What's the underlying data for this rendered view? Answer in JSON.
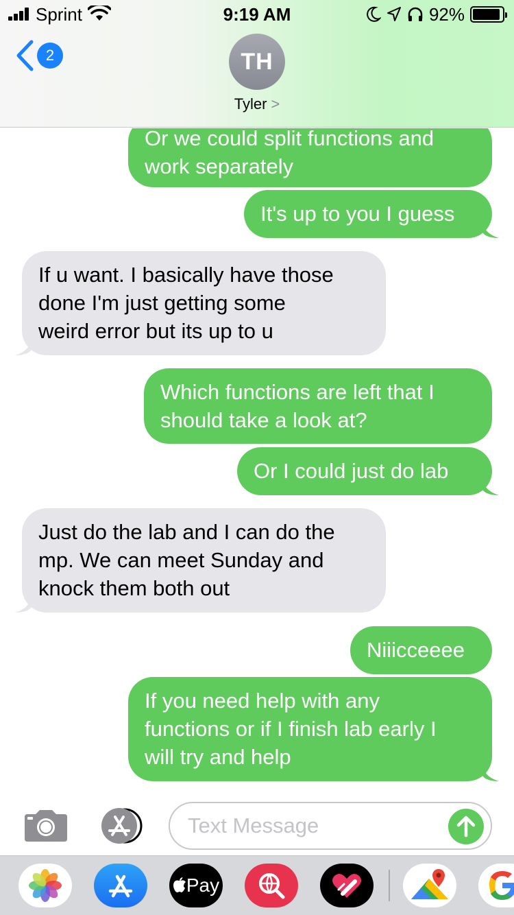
{
  "status_bar": {
    "carrier": "Sprint",
    "time": "9:19 AM",
    "battery_percent": "92%",
    "battery_level": 0.92
  },
  "nav": {
    "back_badge": "2",
    "avatar_initials": "TH",
    "contact_name": "Tyler",
    "contact_chevron": ">"
  },
  "messages": [
    {
      "type": "sent",
      "lines": [
        "Or we could split functions and",
        "work separately"
      ]
    },
    {
      "type": "sent",
      "lines": [
        "It's up to you I guess"
      ]
    },
    {
      "type": "received",
      "lines": [
        "If u want. I basically have those",
        "done I'm just getting some",
        "weird error but its up to u"
      ]
    },
    {
      "type": "sent",
      "lines": [
        "Which functions are left that I",
        "should take a look at?"
      ]
    },
    {
      "type": "sent",
      "lines": [
        "Or I could just do lab"
      ]
    },
    {
      "type": "received",
      "lines": [
        "Just do the lab and I can do the",
        "mp. We can meet Sunday and",
        "knock them both out"
      ]
    },
    {
      "type": "sent",
      "lines": [
        "Niiicceeee"
      ]
    },
    {
      "type": "sent",
      "lines": [
        "If you need help with any",
        "functions or if I finish lab early I",
        "will try and help"
      ]
    }
  ],
  "input": {
    "placeholder": "Text Message"
  },
  "drawer": {
    "apple_pay_label": "Pay",
    "apps": [
      "photos-icon",
      "app-store-icon",
      "apple-pay-icon",
      "web-search-icon",
      "digital-touch-icon",
      "google-maps-icon",
      "google-icon"
    ]
  },
  "colors": {
    "sent_bubble": "#5fcb5d",
    "received_bubble": "#e6e5ea",
    "ios_blue": "#1a82fb"
  }
}
